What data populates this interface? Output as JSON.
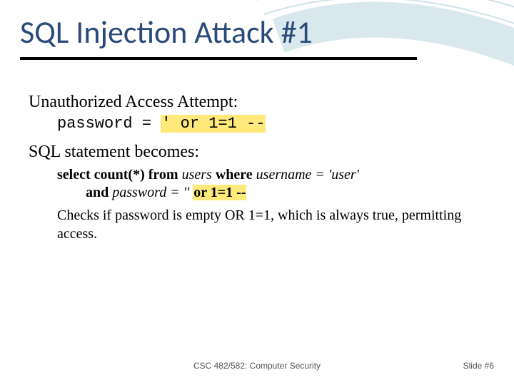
{
  "title": "SQL Injection Attack #1",
  "section1": {
    "heading": "Unauthorized Access Attempt:",
    "code_prefix": "password = ",
    "code_hl": "' or 1=1 --"
  },
  "section2": {
    "heading": "SQL statement becomes:",
    "sql_line1_a": "select count(*) from ",
    "sql_line1_b": "users ",
    "sql_line1_c": "where ",
    "sql_line1_d": "username = 'user'",
    "sql_line2_a": "and ",
    "sql_line2_b": "password = '' ",
    "sql_line2_hl": "or 1=1 --",
    "explain": "Checks if password is empty OR 1=1, which is always true, permitting access."
  },
  "footer": {
    "center": "CSC 482/582: Computer Security",
    "right": "Slide #6"
  }
}
